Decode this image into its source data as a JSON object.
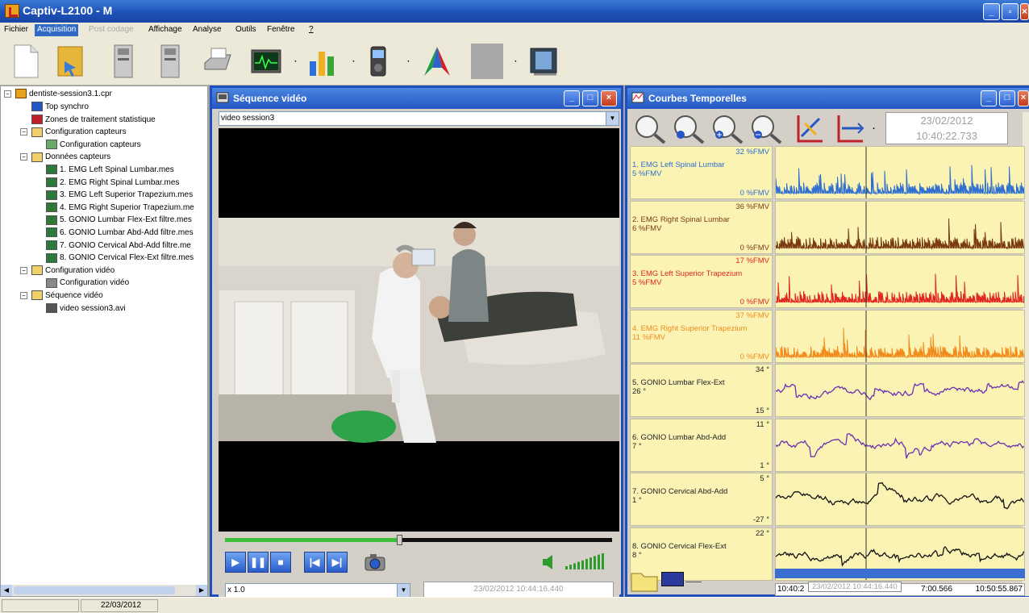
{
  "app": {
    "title": "Captiv-L2100 - M"
  },
  "menu": [
    {
      "label": "Fichier",
      "state": "normal"
    },
    {
      "label": "Acquisition",
      "state": "active"
    },
    {
      "label": "Post codage",
      "state": "disabled"
    },
    {
      "label": "Affichage",
      "state": "normal"
    },
    {
      "label": "Analyse",
      "state": "normal"
    },
    {
      "label": "Outils",
      "state": "normal"
    },
    {
      "label": "Fenêtre",
      "state": "normal"
    },
    {
      "label": "?",
      "state": "normal"
    }
  ],
  "toolbar": {
    "icons": [
      "new-file-icon",
      "open-folder-icon",
      "sensor-device-icon",
      "sensor-device-2-icon",
      "printer-icon",
      "monitor-signal-icon",
      "bar-chart-icon",
      "video-camera-icon",
      "arrow-logo-icon",
      "blank-tool-icon",
      "video-file-icon"
    ]
  },
  "tree": {
    "root": "dentiste-session3.1.cpr",
    "items": [
      {
        "label": "Top synchro",
        "icon": "sync-flag-icon"
      },
      {
        "label": "Zones de traitement statistique",
        "icon": "stats-zone-icon"
      },
      {
        "label": "Configuration capteurs",
        "icon": "folder-icon",
        "expander": "−"
      },
      {
        "label": "Configuration capteurs",
        "icon": "sensor-config-icon"
      },
      {
        "label": "Données capteurs",
        "icon": "folder-icon",
        "expander": "−"
      },
      {
        "label": "1. EMG Left Spinal Lumbar.mes",
        "icon": "signal-file-icon"
      },
      {
        "label": "2. EMG Right Spinal Lumbar.mes",
        "icon": "signal-file-icon"
      },
      {
        "label": "3. EMG Left Superior Trapezium.mes",
        "icon": "signal-file-icon"
      },
      {
        "label": "4. EMG Right Superior Trapezium.me",
        "icon": "signal-file-icon"
      },
      {
        "label": "5. GONIO Lumbar Flex-Ext filtre.mes",
        "icon": "signal-file-icon"
      },
      {
        "label": "6. GONIO Lumbar Abd-Add filtre.mes",
        "icon": "signal-file-icon"
      },
      {
        "label": "7. GONIO Cervical Abd-Add filtre.me",
        "icon": "signal-file-icon"
      },
      {
        "label": "8. GONIO Cervical Flex-Ext filtre.mes",
        "icon": "signal-file-icon"
      },
      {
        "label": "Configuration vidéo",
        "icon": "folder-icon",
        "expander": "−"
      },
      {
        "label": "Configuration vidéo",
        "icon": "video-config-icon"
      },
      {
        "label": "Séquence vidéo",
        "icon": "folder-icon",
        "expander": "−"
      },
      {
        "label": "video session3.avi",
        "icon": "video-file-icon"
      }
    ]
  },
  "video_window": {
    "title": "Séquence vidéo",
    "source": "video session3",
    "speed": "x 1.0",
    "timestamp": "23/02/2012 10:44:16.440",
    "progress": 0.45
  },
  "curves_window": {
    "title": "Courbes Temporelles",
    "date": "23/02/2012",
    "time": "10:40:22.733",
    "tracks": [
      {
        "max": "32 %FMV",
        "name": "1. EMG Left Spinal Lumbar",
        "sub": "5 %FMV",
        "min": "0 %FMV",
        "color": "#2e6fd1",
        "kind": "emg"
      },
      {
        "max": "36 %FMV",
        "name": "2. EMG Right Spinal Lumbar",
        "sub": "6 %FMV",
        "min": "0 %FMV",
        "color": "#7a3b12",
        "kind": "emg"
      },
      {
        "max": "17 %FMV",
        "name": "3. EMG Left Superior Trapezium",
        "sub": "5 %FMV",
        "min": "0 %FMV",
        "color": "#e0261f",
        "kind": "emg"
      },
      {
        "max": "37 %FMV",
        "name": "4. EMG Right Superior Trapezium",
        "sub": "11 %FMV",
        "min": "0 %FMV",
        "color": "#f08b1c",
        "kind": "emg"
      },
      {
        "max": "34 °",
        "name": "5. GONIO Lumbar Flex-Ext",
        "sub": "26 °",
        "min": "15 °",
        "color": "#6b2fb3",
        "kind": "gonio"
      },
      {
        "max": "11 °",
        "name": "6. GONIO Lumbar Abd-Add",
        "sub": "7 °",
        "min": "1 °",
        "color": "#6b2fb3",
        "kind": "gonio"
      },
      {
        "max": "5 °",
        "name": "7. GONIO Cervical Abd-Add",
        "sub": "1 °",
        "min": "-27 °",
        "color": "#111111",
        "kind": "gonio"
      },
      {
        "max": "22 °",
        "name": "8. GONIO Cervical Flex-Ext",
        "sub": "8 °",
        "min": "",
        "color": "#111111",
        "kind": "gonio"
      }
    ],
    "timeline": {
      "start": "10:40:2",
      "cursor": "23/02/2012 10:44:16.440",
      "mid": "7:00.566",
      "end": "10:50:55.867"
    }
  },
  "statusbar": {
    "date": "22/03/2012"
  }
}
